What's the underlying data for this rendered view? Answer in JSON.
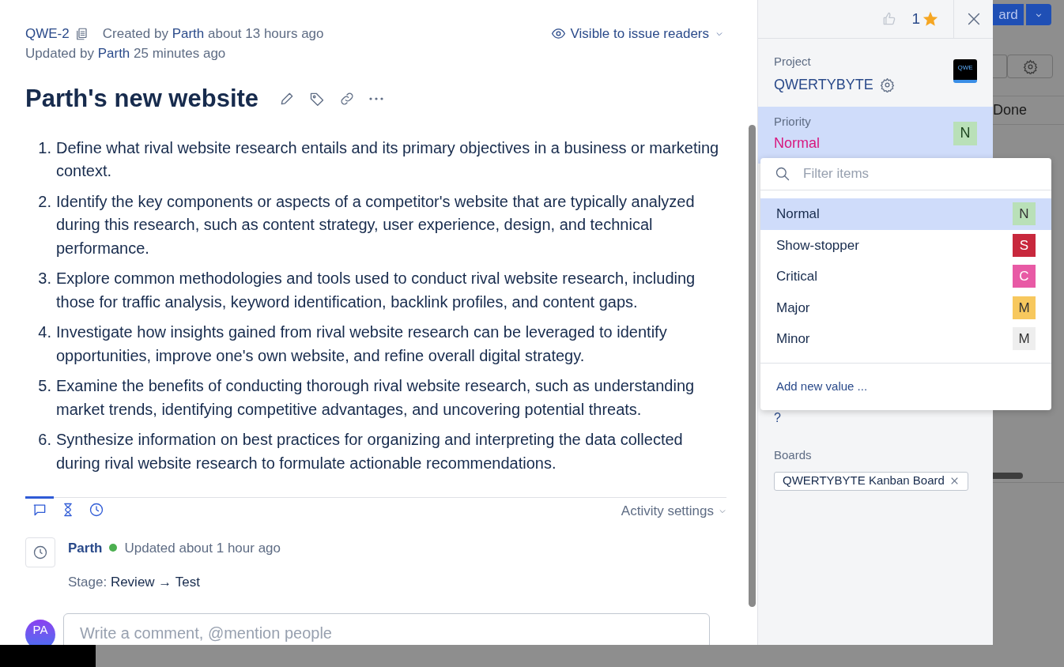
{
  "issue": {
    "id": "QWE-2",
    "created_prefix": "Created by",
    "created_by": "Parth",
    "created_time": "about 13 hours ago",
    "updated_prefix": "Updated by",
    "updated_by": "Parth",
    "updated_time": "25 minutes ago",
    "visibility": "Visible to issue readers",
    "title": "Parth's new website"
  },
  "description": [
    {
      "number": "1.",
      "text": "Define what rival website research entails and its primary objectives in a business or marketing context."
    },
    {
      "number": "2.",
      "text": "Identify the key components or aspects of a competitor's website that are typically analyzed during this research, such as content strategy, user experience, design, and technical performance."
    },
    {
      "number": "3.",
      "text": "Explore common methodologies and tools used to conduct rival website research, including those for traffic analysis, keyword identification, backlink profiles, and content gaps."
    },
    {
      "number": "4.",
      "text": "Investigate how insights gained from rival website research can be leveraged to identify opportunities, improve one's own website, and refine overall digital strategy."
    },
    {
      "number": "5.",
      "text": "Examine the benefits of conducting thorough rival website research, such as understanding market trends, identifying competitive advantages, and uncovering potential threats."
    },
    {
      "number": "6.",
      "text": "Synthesize information on best practices for organizing and interpreting the data collected during rival website research to formulate actionable recommendations."
    }
  ],
  "activity": {
    "tabs": [
      {
        "kind": "comments",
        "selected": true
      },
      {
        "kind": "time",
        "selected": false
      },
      {
        "kind": "history",
        "selected": false
      }
    ],
    "settings": "Activity settings",
    "entries": [
      {
        "author": "Parth",
        "online": true,
        "time": "Updated about 1 hour ago",
        "field": "Stage:",
        "change": "Review → Test"
      }
    ],
    "comment_avatar": "PA",
    "comment_placeholder": "Write a comment, @mention people"
  },
  "sidebar": {
    "votes": "1",
    "project_label": "Project",
    "project": "QWERTYBYTE",
    "project_logo": "QWE",
    "priority_label": "Priority",
    "priority": "Normal",
    "priority_badge": {
      "letter": "N",
      "color": "#b9e0b8"
    },
    "hidden_value": "?",
    "boards_label": "Boards",
    "boards": [
      "QWERTYBYTE Kanban Board"
    ]
  },
  "dropdown": {
    "placeholder": "Filter items",
    "items": [
      {
        "label": "Normal",
        "letter": "N",
        "color": "#b9e0b8",
        "selected": true
      },
      {
        "label": "Show-stopper",
        "letter": "S",
        "color": "#c8283d",
        "selected": false
      },
      {
        "label": "Critical",
        "letter": "C",
        "color": "#e85aa5",
        "selected": false
      },
      {
        "label": "Major",
        "letter": "M",
        "color": "#f7c85e",
        "selected": false
      },
      {
        "label": "Minor",
        "letter": "M",
        "color": "#eeeeee",
        "selected": false
      }
    ],
    "add_value": "Add new value ..."
  },
  "background": {
    "button_text": "ard",
    "column_header": "Done"
  }
}
